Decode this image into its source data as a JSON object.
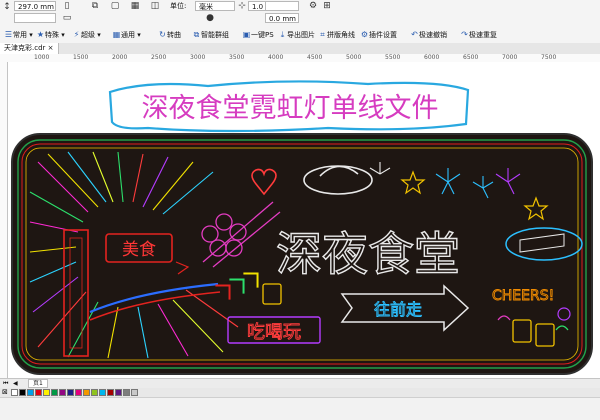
{
  "property_bar": {
    "height_value": "297.0 mm",
    "unit_label": "单位:",
    "unit_value": "毫米",
    "nudge_value": "1.0 mm",
    "dup_y_value": "0.0 mm"
  },
  "toolbar": {
    "items": [
      {
        "label": "常用",
        "icon": "list-icon"
      },
      {
        "label": "特殊",
        "icon": "star-icon"
      },
      {
        "label": "超级",
        "icon": "lightning-icon"
      },
      {
        "label": "通用",
        "icon": "grid-icon"
      },
      {
        "label": "转曲",
        "icon": "curve-icon"
      },
      {
        "label": "智能群组",
        "icon": "group-icon"
      },
      {
        "label": "一键PS",
        "icon": "ps-icon"
      },
      {
        "label": "导出图片",
        "icon": "export-icon"
      },
      {
        "label": "拼版角线",
        "icon": "crop-icon"
      },
      {
        "label": "插件设置",
        "icon": "gear-icon"
      },
      {
        "label": "极速撤销",
        "icon": "undo-icon"
      },
      {
        "label": "极速重复",
        "icon": "redo-icon"
      }
    ]
  },
  "document_tab": {
    "label": "天津克彩.cdr"
  },
  "ruler": {
    "ticks": [
      "1000",
      "1500",
      "2000",
      "2500",
      "3000",
      "3500",
      "4000",
      "4500",
      "5000",
      "5500",
      "6000",
      "6500",
      "7000",
      "7500"
    ]
  },
  "artwork": {
    "title": "深夜食堂霓虹灯单线文件",
    "title_color": "#e040c0",
    "sign_text_meishi": "美食",
    "sign_text_main": "深夜食堂",
    "sign_text_chihewan": "吃喝玩",
    "sign_text_arrow": "往前走",
    "sign_text_cheers": "CHEERS!"
  },
  "page_nav": {
    "page_label": "页1"
  },
  "palette": {
    "colors": [
      "#ffffff",
      "#000000",
      "#00a0e9",
      "#e60012",
      "#fff100",
      "#009944",
      "#920783",
      "#1d2088",
      "#e4007f",
      "#f39800",
      "#8fc31f",
      "#00b7ee",
      "#a40000",
      "#601986",
      "#7d7d7d",
      "#c9c9c9"
    ]
  },
  "colors": {
    "neon_outline": "#2a8a3a",
    "board": "#201712"
  }
}
